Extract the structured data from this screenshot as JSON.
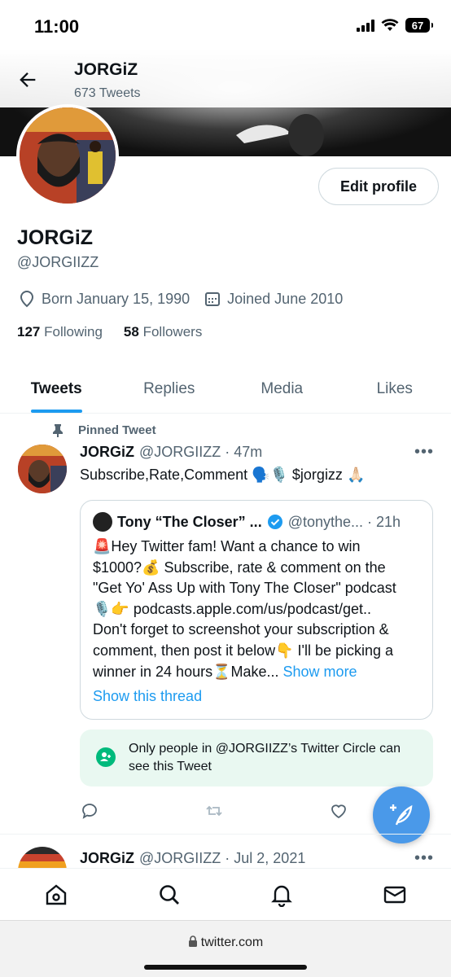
{
  "status": {
    "time": "11:00",
    "battery": "67"
  },
  "header": {
    "name": "JORGiZ",
    "tweet_count": "673 Tweets"
  },
  "profile": {
    "edit_label": "Edit profile",
    "name": "JORGiZ",
    "handle": "@JORGIIZZ",
    "born": "Born January 15, 1990",
    "joined": "Joined June 2010",
    "following_count": "127",
    "following_label": "Following",
    "followers_count": "58",
    "followers_label": "Followers"
  },
  "tabs": [
    {
      "label": "Tweets"
    },
    {
      "label": "Replies"
    },
    {
      "label": "Media"
    },
    {
      "label": "Likes"
    }
  ],
  "pinned_tweet": {
    "pinned_label": "Pinned Tweet",
    "name": "JORGiZ",
    "handle_time": "@JORGIIZZ · 47m",
    "text": "Subscribe,Rate,Comment 🗣️🎙️ $jorgizz 🙏🏻",
    "quote": {
      "name": "Tony “The Closer” ...",
      "handle_time": "@tonythe...  · 21h",
      "lines": [
        "🚨Hey Twitter fam! Want a chance to win",
        "$1000?💰 Subscribe, rate & comment on the",
        "\"Get Yo' Ass Up with Tony The Closer\" podcast",
        "🎙️👉 podcasts.apple.com/us/podcast/get..",
        "Don't forget to screenshot your subscription &",
        "comment, then post it below👇 I'll be picking a",
        "winner in 24 hours⏳Make..."
      ],
      "show_more": "Show more",
      "show_thread": "Show this thread"
    },
    "circle_notice": "Only people in @JORGIIZZ’s Twitter Circle can see this Tweet"
  },
  "second_tweet": {
    "name": "JORGiZ",
    "handle_time": "@JORGIIZZ · Jul 2, 2021"
  },
  "browser": {
    "url": "twitter.com"
  },
  "colors": {
    "accent": "#1d9bf0",
    "circle_green": "#00ba7c",
    "fab": "#4a99e9"
  },
  "icons": [
    "back-arrow-icon",
    "location-icon",
    "calendar-icon",
    "pin-icon",
    "reply-icon",
    "retweet-icon",
    "like-icon",
    "compose-icon",
    "home-icon",
    "search-icon",
    "bell-icon",
    "mail-icon",
    "lock-icon"
  ]
}
